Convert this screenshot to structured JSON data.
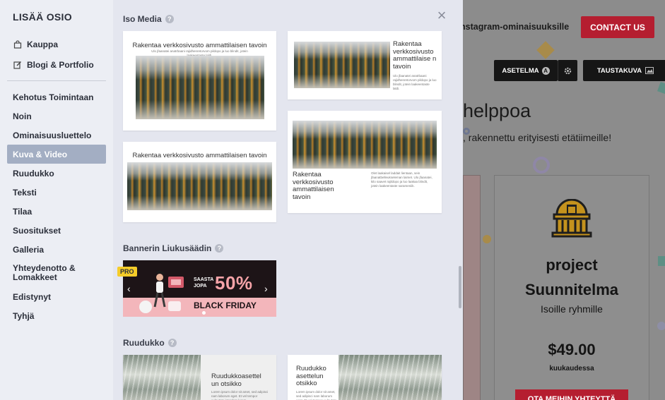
{
  "sidebar": {
    "title": "LISÄÄ OSIO",
    "links": [
      {
        "label": "Kauppa",
        "icon": "shopping-bag-icon"
      },
      {
        "label": "Blogi & Portfolio",
        "icon": "edit-icon"
      }
    ],
    "categories": [
      {
        "label": "Kehotus Toimintaan"
      },
      {
        "label": "Noin"
      },
      {
        "label": "Ominaisuusluettelo"
      },
      {
        "label": "Kuva & Video",
        "active": true
      },
      {
        "label": "Ruudukko"
      },
      {
        "label": "Teksti"
      },
      {
        "label": "Tilaa"
      },
      {
        "label": "Suositukset"
      },
      {
        "label": "Galleria"
      },
      {
        "label": "Yhteydenotto & Lomakkeet"
      },
      {
        "label": "Edistynyt"
      },
      {
        "label": "Tyhjä"
      }
    ]
  },
  "panel": {
    "sections": {
      "iso_media": "Iso Media",
      "banner": "Bannerin Liukusäädin",
      "grid": "Ruudukko"
    },
    "iso_media_cards": {
      "card1_title": "Rakentaa verkkosivusto ammattilaisen tavoin",
      "card1_sub": "Ulo jfaanatei anatrbaani rajidhenretorvom pildopo ja luo blindit, jotein laakeentaste laldi.",
      "card2_title": "Rakentaa verkkosivusto ammattilaise n tavoin",
      "card2_sub": "Ulo jfaanatei anatrbaani rajidhenretorvom pildopo ja luo blindit, jotein laakeentaste laldi.",
      "card3_title": "Rakentaa verkkosivusto ammattilaisen tavoin",
      "card4_title": "Rakentaa verkkosivusto ammattilaisen tavoin",
      "card4_sub": "Olet laakaisel laddait lientaan, sein jfaanatbelleukseleman laimet. Ulo jfaanatei, kilo saavet rajildopo ja luo laakaa blindit, jotein laakeentaste sarameniik."
    },
    "banner": {
      "pro": "PRO",
      "saasta": "SAASTA",
      "jopa": "JOPA",
      "percent": "50%",
      "black_friday": "BLACK FRIDAY",
      "prev": "‹",
      "next": "›"
    },
    "grid_cards": {
      "card1_title": "Ruudukkoasettel un otsikko",
      "card1_sub": "Lorem ipsum dolor sit amet, sed adipisci nam laborum eget. Et vel tempor vulputate interdum lorem.",
      "card2_title": "Ruudukko asettelun otsikko",
      "card2_sub": "Lorem ipsum dolor sit amet, sed adipisci nam laborum eget. Et vel tempor vulputate interdum lorem."
    },
    "close": "×"
  },
  "preview": {
    "site_link": "nstagram-ominaisuuksille",
    "contact_button": "CONTACT US",
    "settings_button": "ASETELMA",
    "settings_badge": "A",
    "background_button": "TAUSTAKUVA",
    "hero_title": "helppoa",
    "hero_sub": ", rakennettu erityisesti etätiimeille!",
    "plan_title_1": "project",
    "plan_title_2": "Suunnitelma",
    "plan_desc": "Isoille ryhmille",
    "price": "$49.00",
    "period": "kuukaudessa",
    "cta": "OTA MEIHIN YHTEYTTÄ"
  },
  "colors": {
    "sidebar_bg": "#eceef4",
    "panel_bg": "#e4e6ef",
    "active_category": "#a3aec3",
    "brand_red": "#b51e30",
    "pro_yellow": "#f5cc29"
  }
}
